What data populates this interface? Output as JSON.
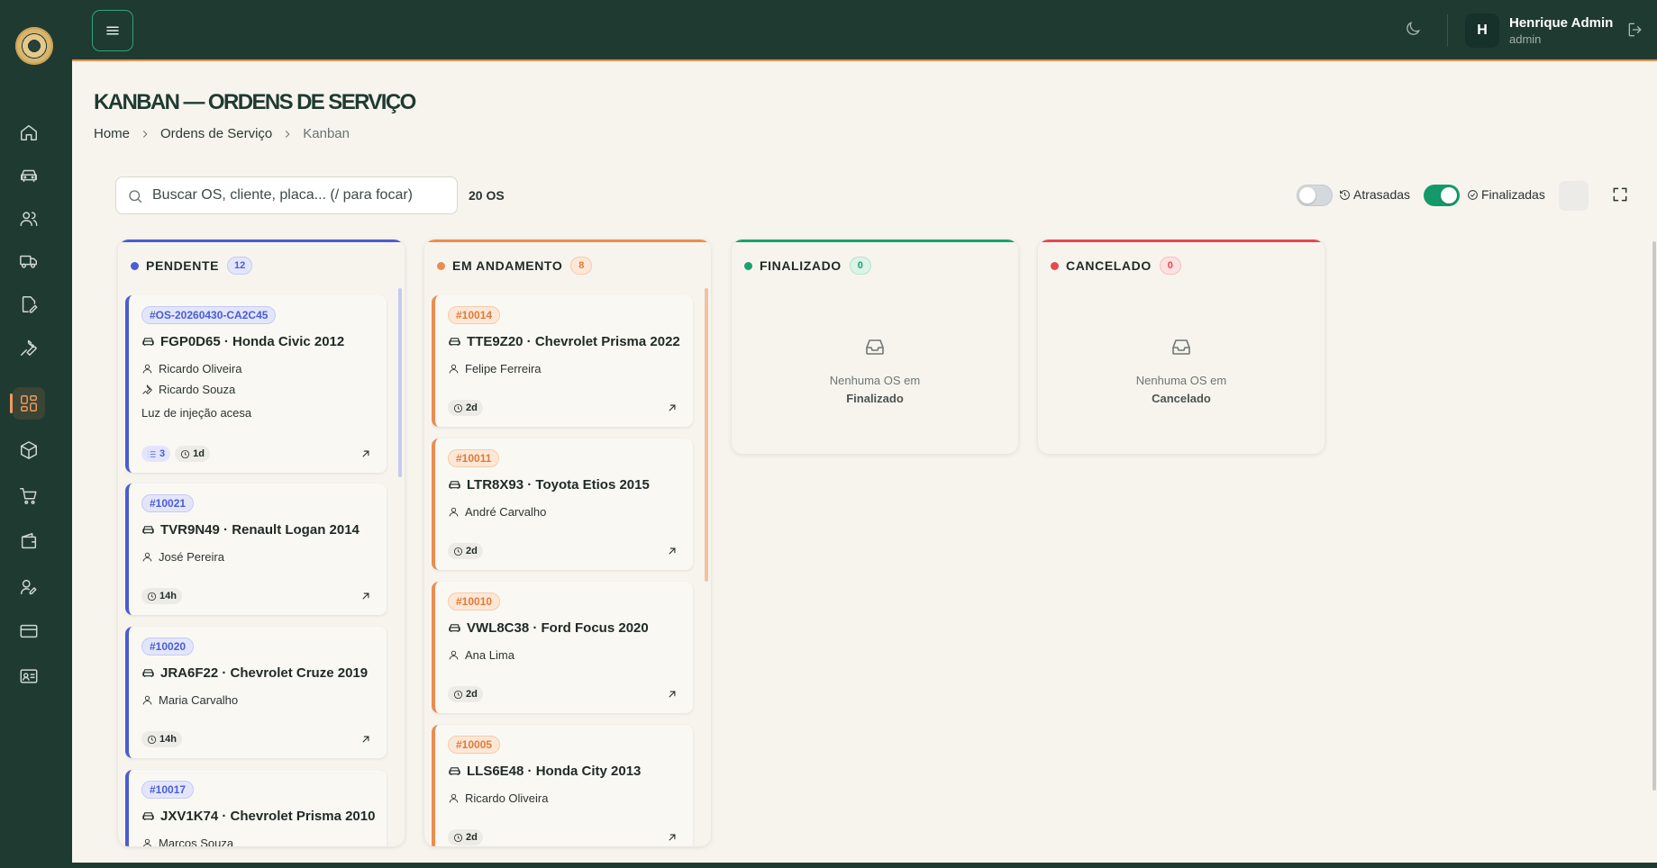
{
  "header": {
    "user_name": "Henrique Admin",
    "user_role": "admin",
    "avatar_initial": "H"
  },
  "sidebar": {
    "items": [
      {
        "icon": "home-icon",
        "active": false
      },
      {
        "icon": "car-icon",
        "active": false
      },
      {
        "icon": "users-icon",
        "active": false
      },
      {
        "icon": "truck-icon",
        "active": false
      },
      {
        "icon": "edit-document-icon",
        "active": false
      },
      {
        "icon": "wrench-icon",
        "active": false
      },
      {
        "icon": "kanban-icon",
        "active": true
      },
      {
        "icon": "box-icon",
        "active": false
      },
      {
        "icon": "cart-icon",
        "active": false
      },
      {
        "icon": "wallet-icon",
        "active": false
      },
      {
        "icon": "user-edit-icon",
        "active": false
      },
      {
        "icon": "credit-card-icon",
        "active": false
      },
      {
        "icon": "id-card-icon",
        "active": false
      }
    ]
  },
  "page": {
    "title": "KANBAN — ORDENS DE SERVIÇO",
    "breadcrumb": [
      "Home",
      "Ordens de Serviço",
      "Kanban"
    ]
  },
  "toolbar": {
    "search_placeholder": "Buscar OS, cliente, placa... (/ para focar)",
    "count": "20 OS",
    "toggle_late_label": "Atrasadas",
    "toggle_late_on": false,
    "toggle_done_label": "Finalizadas",
    "toggle_done_on": true
  },
  "colors": {
    "pendente": "#4a5cd6",
    "andamento": "#ea8d50",
    "finalizado": "#17a36c",
    "cancelado": "#e5484d",
    "primary": "#1f3a31"
  },
  "columns": [
    {
      "title": "PENDENTE",
      "count": "12",
      "cards": [
        {
          "id": "#OS-20260430-CA2C45",
          "vehicle": "FGP0D65 · Honda Civic 2012",
          "client": "Ricardo Oliveira",
          "mechanic": "Ricardo Souza",
          "description": "Luz de injeção acesa",
          "tasks": "3",
          "age": "1d"
        },
        {
          "id": "#10021",
          "vehicle": "TVR9N49 · Renault Logan 2014",
          "client": "José Pereira",
          "age": "14h"
        },
        {
          "id": "#10020",
          "vehicle": "JRA6F22 · Chevrolet Cruze 2019",
          "client": "Maria Carvalho",
          "age": "14h"
        },
        {
          "id": "#10017",
          "vehicle": "JXV1K74 · Chevrolet Prisma 2010",
          "client": "Marcos Souza"
        }
      ]
    },
    {
      "title": "EM ANDAMENTO",
      "count": "8",
      "cards": [
        {
          "id": "#10014",
          "vehicle": "TTE9Z20 · Chevrolet Prisma 2022",
          "client": "Felipe Ferreira",
          "age": "2d"
        },
        {
          "id": "#10011",
          "vehicle": "LTR8X93 · Toyota Etios 2015",
          "client": "André Carvalho",
          "age": "2d"
        },
        {
          "id": "#10010",
          "vehicle": "VWL8C38 · Ford Focus 2020",
          "client": "Ana Lima",
          "age": "2d"
        },
        {
          "id": "#10005",
          "vehicle": "LLS6E48 · Honda City 2013",
          "client": "Ricardo Oliveira",
          "age": "2d"
        }
      ]
    },
    {
      "title": "FINALIZADO",
      "count": "0",
      "empty_message": "Nenhuma OS em",
      "empty_status": "Finalizado"
    },
    {
      "title": "CANCELADO",
      "count": "0",
      "empty_message": "Nenhuma OS em",
      "empty_status": "Cancelado"
    }
  ]
}
